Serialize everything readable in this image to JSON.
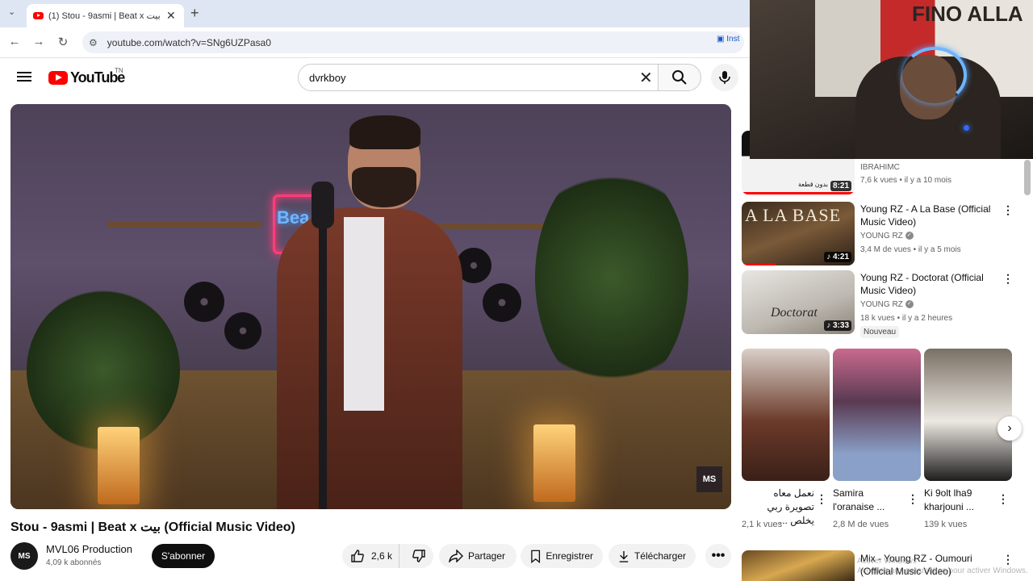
{
  "browser": {
    "tab_title": "(1) Stou - 9asmi | Beat x بيت (O",
    "url": "youtube.com/watch?v=SNg6UZPasa0",
    "install_label": "Inst"
  },
  "header": {
    "logo_text": "YouTube",
    "region": "TN",
    "search_query": "dvrkboy"
  },
  "video": {
    "title": "Stou - 9asmi | Beat x بيت (Official Music Video)",
    "neon_sign": "Bea",
    "watermark": "MS",
    "channel_name": "MVL06 Production",
    "channel_subscribers": "4,09 k abonnés",
    "avatar_text": "MS",
    "subscribe_label": "S'abonner",
    "likes": "2,6 k",
    "share_label": "Partager",
    "save_label": "Enregistrer",
    "download_label": "Télécharger",
    "more_label": "•••"
  },
  "sidebar": {
    "items": [
      {
        "channel": "IBRAHIMC",
        "meta": "7,6 k vues • il y a 10 mois",
        "duration": "8:21",
        "thumb_text": "بدون قطعة",
        "watched_fraction": 0.0
      },
      {
        "title": "Young RZ - A La Base (Official Music Video)",
        "channel": "YOUNG RZ",
        "meta": "3,4 M de vues • il y a 5 mois",
        "duration": "4:21",
        "thumb_text": "A LA BASE",
        "watched_fraction": 0.3
      },
      {
        "title": "Young RZ - Doctorat (Official Music Video)",
        "channel": "YOUNG RZ",
        "meta": "18 k vues • il y a 2 heures",
        "duration": "3:33",
        "thumb_text": "Doctorat",
        "badge": "Nouveau",
        "watched_fraction": 0.0
      }
    ],
    "shorts": [
      {
        "title": "نعمل معاه تصويرة ربي يخلص ...",
        "views": "2,1 k vues"
      },
      {
        "title": "Samira l'oranaise ...",
        "views": "2,8 M de vues"
      },
      {
        "title": "Ki 9olt lha9 kharjouni ...",
        "views": "139 k vues"
      }
    ],
    "next_item": {
      "title": "Mix - Young RZ - Oumouri (Official Music Video)"
    }
  },
  "webcam": {
    "backdrop_text": "FINO ALLA"
  },
  "os": {
    "activation_watermark": "Activer Windows\nAccédez aux paramètres pour activer Windows."
  },
  "colors": {
    "brand_red": "#ff0000",
    "subscribe_bg": "#0f0f0f",
    "pill_bg": "#f2f2f2"
  }
}
